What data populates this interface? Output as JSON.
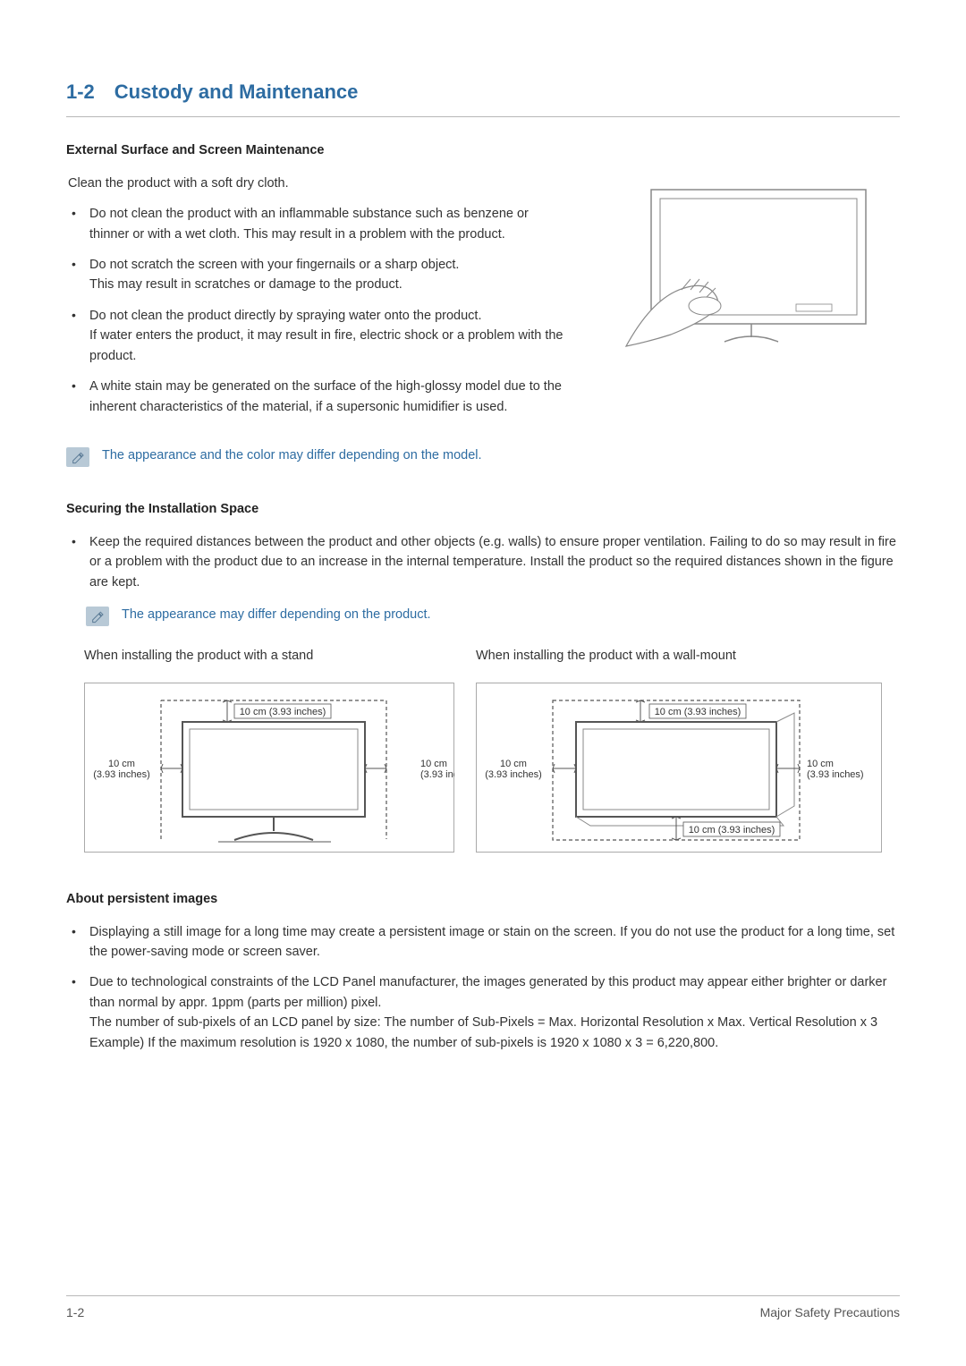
{
  "section": {
    "number": "1-2",
    "title": "Custody and Maintenance"
  },
  "external": {
    "heading": "External Surface and Screen Maintenance",
    "intro": "Clean the product with a soft dry cloth.",
    "bullets": [
      {
        "main": "Do not clean the product with an inflammable substance such as benzene or thinner or with a wet cloth. This may result in a problem with the product."
      },
      {
        "main": "Do not scratch the screen with your fingernails or a sharp object.",
        "sub": "This may result in scratches or damage to the product."
      },
      {
        "main": "Do not clean the product directly by spraying water onto the product.",
        "sub": "If water enters the product, it may result in fire, electric shock or a problem with the product."
      },
      {
        "main": "A white stain may be generated on the surface of the high-glossy model due to the inherent characteristics of the material, if a supersonic humidifier is used."
      }
    ],
    "note": "The appearance and the color may differ depending on the model."
  },
  "securing": {
    "heading": "Securing the Installation Space",
    "bullet": "Keep the required distances between the product and other objects (e.g. walls) to ensure proper ventilation. Failing to do so may result in fire or a problem with the product due to an increase in the internal temperature. Install the product so the required distances shown in the figure are kept.",
    "note": "The appearance may differ depending on the product.",
    "captions": {
      "stand": "When installing the product with a stand",
      "wall": "When installing the product with a wall-mount"
    },
    "labels": {
      "top": "10 cm (3.93 inches)",
      "left_a": "10 cm",
      "left_b": "(3.93 inches)",
      "right_a": "10 cm",
      "right_b": "(3.93 inches)",
      "bottom": "10 cm (3.93 inches)"
    }
  },
  "persistent": {
    "heading": "About persistent images",
    "bullets": [
      {
        "main": "Displaying a still image for a long time may create a persistent image or stain on the screen. If you do not use the product for a long time, set the power-saving mode or screen saver."
      },
      {
        "main": "Due to technological constraints of the LCD Panel manufacturer, the images generated by this product may appear either brighter or darker than normal by appr. 1ppm (parts per million) pixel.",
        "sub1": "The number of sub-pixels of an LCD panel by size:  The number of Sub-Pixels = Max. Horizontal Resolution x Max. Vertical Resolution x 3",
        "sub2": "Example) If the maximum resolution is 1920 x 1080, the number of sub-pixels is 1920 x 1080 x 3 = 6,220,800."
      }
    ]
  },
  "footer": {
    "left": "1-2",
    "right": "Major Safety Precautions"
  }
}
